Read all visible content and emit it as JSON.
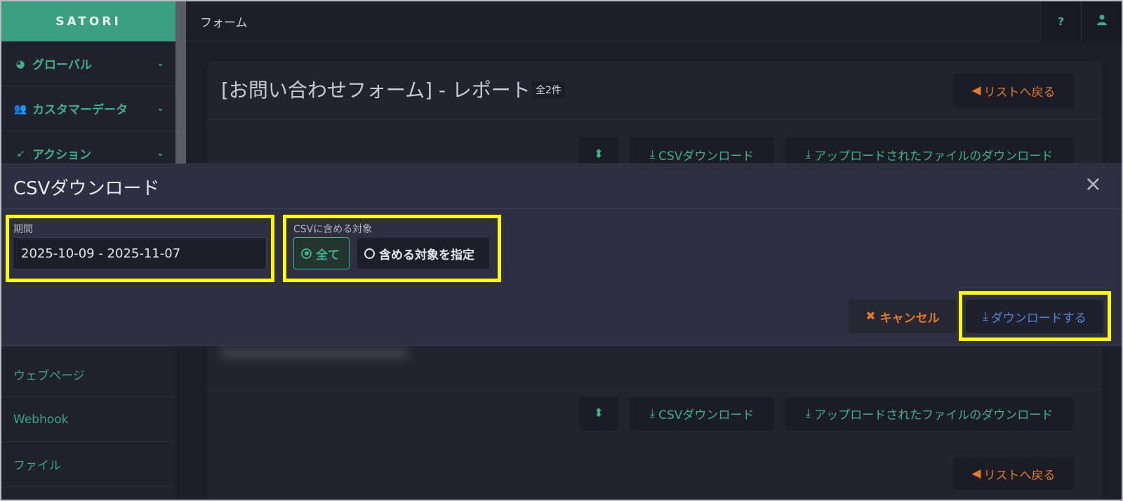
{
  "sidebar": {
    "brand": "SATORI",
    "items": [
      {
        "label": "グローバル",
        "icon": "dashboard-icon"
      },
      {
        "label": "カスタマーデータ",
        "icon": "users-icon"
      },
      {
        "label": "アクション",
        "icon": "rocket-icon"
      }
    ],
    "sub_items": [
      {
        "label": "ウェブページ"
      },
      {
        "label": "Webhook"
      },
      {
        "label": "ファイル"
      }
    ]
  },
  "topbar": {
    "title": "フォーム",
    "help_label": "?",
    "user_icon": "user-icon"
  },
  "card": {
    "title": "[お問い合わせフォーム] - レポート",
    "count": "全2件",
    "back_label": "リストへ戻る",
    "sort_icon": "sort-icon",
    "csv_download_label": "CSVダウンロード",
    "uploaded_download_label": "アップロードされたファイルのダウンロード"
  },
  "modal": {
    "title": "CSVダウンロード",
    "close": "×",
    "period_label": "期間",
    "period_value": "2025-10-09 - 2025-11-07",
    "target_label": "CSVに含める対象",
    "radio_all": "全て",
    "radio_specify": "含める対象を指定",
    "cancel_label": "キャンセル",
    "download_label": "ダウンロードする"
  },
  "colors": {
    "accent_green": "#3fb08b",
    "orange": "#e07b2c",
    "blue": "#4b86d8",
    "highlight": "#ffff00"
  }
}
